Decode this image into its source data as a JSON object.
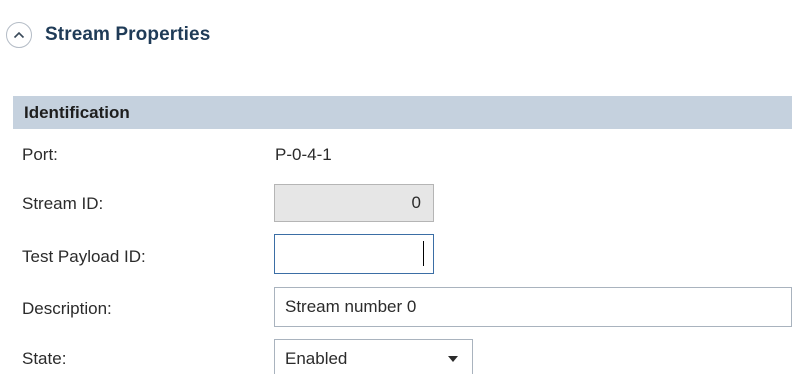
{
  "section": {
    "title": "Stream Properties",
    "toggle_icon": "chevron-up-icon"
  },
  "group": {
    "title": "Identification"
  },
  "fields": {
    "port": {
      "label": "Port:",
      "value": "P-0-4-1"
    },
    "stream_id": {
      "label": "Stream ID:",
      "value": "0"
    },
    "test_payload_id": {
      "label": "Test Payload ID:",
      "value": ""
    },
    "description": {
      "label": "Description:",
      "value": "Stream number 0"
    },
    "state": {
      "label": "State:",
      "value": "Enabled",
      "icon": "dropdown-arrow-icon"
    }
  },
  "colors": {
    "section_title": "#1f3b57",
    "group_header_bg": "#c5d1de",
    "readonly_bg": "#e6e6e6",
    "border": "#a9b3be"
  }
}
